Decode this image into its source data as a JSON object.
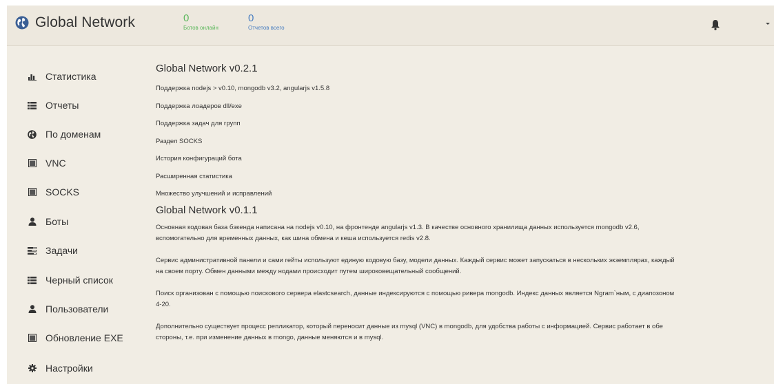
{
  "header": {
    "title": "Global Network",
    "stats": [
      {
        "value": "0",
        "label": "Ботов онлайн"
      },
      {
        "value": "0",
        "label": "Отчетов всего"
      }
    ]
  },
  "sidebar": {
    "items": [
      {
        "label": "Статистика",
        "icon": "bar-chart-icon"
      },
      {
        "label": "Отчеты",
        "icon": "list-icon"
      },
      {
        "label": "По доменам",
        "icon": "globe-icon"
      },
      {
        "label": "VNC",
        "icon": "window-icon"
      },
      {
        "label": "SOCKS",
        "icon": "window-icon"
      },
      {
        "label": "Боты",
        "icon": "user-icon"
      },
      {
        "label": "Задачи",
        "icon": "tasks-icon"
      },
      {
        "label": "Черный список",
        "icon": "list-icon"
      },
      {
        "label": "Пользователи",
        "icon": "user-icon"
      },
      {
        "label": "Обновление EXE",
        "icon": "window-icon"
      },
      {
        "label": "Настройки",
        "icon": "gear-icon"
      }
    ]
  },
  "changelog": {
    "v021": {
      "title": "Global Network v0.2.1",
      "items": [
        "Поддержка nodejs > v0.10, mongodb v3.2, angularjs v1.5.8",
        "Поддержка лоадеров dll/exe",
        "Поддержка задач для групп",
        "Раздел SOCKS",
        "История конфигураций бота",
        "Расширенная статистика",
        "Множество улучшений и исправлений"
      ]
    },
    "v011": {
      "title": "Global Network v0.1.1",
      "paragraphs": [
        {
          "l1": "Основная кодовая база бэкенда написана на nodejs v0.10, на фронтенде angularjs v1.3. В качестве основного хранилища данных используется mongodb v2.6,",
          "l2": "вспомогательно для временных данных, как шина обмена и кеша используется redis v2.8."
        },
        {
          "l1": "Сервис административной панели и сами гейты используют единую кодовую базу, модели данных. Каждый сервис может запускаться в нескольких экземплярах, каждый",
          "l2": "на своем порту. Обмен данными между нодами происходит путем широковещательный сообщений."
        },
        {
          "l1": "Поиск организован с помощью поискового сервера elastcsearch, данные индексируются с помощью ривера mongodb. Индекс данных является Ngram`ным, с диапозоном",
          "l2": "4-20."
        },
        {
          "l1": "Дополнительно существует процесс репликатор, который переносит данные из mysql (VNC) в mongodb, для удобства работы с информацией. Сервис работает в обе",
          "l2": "стороны, т.е. при изменение данных в mongo, данные меняются и в mysql."
        }
      ]
    }
  }
}
